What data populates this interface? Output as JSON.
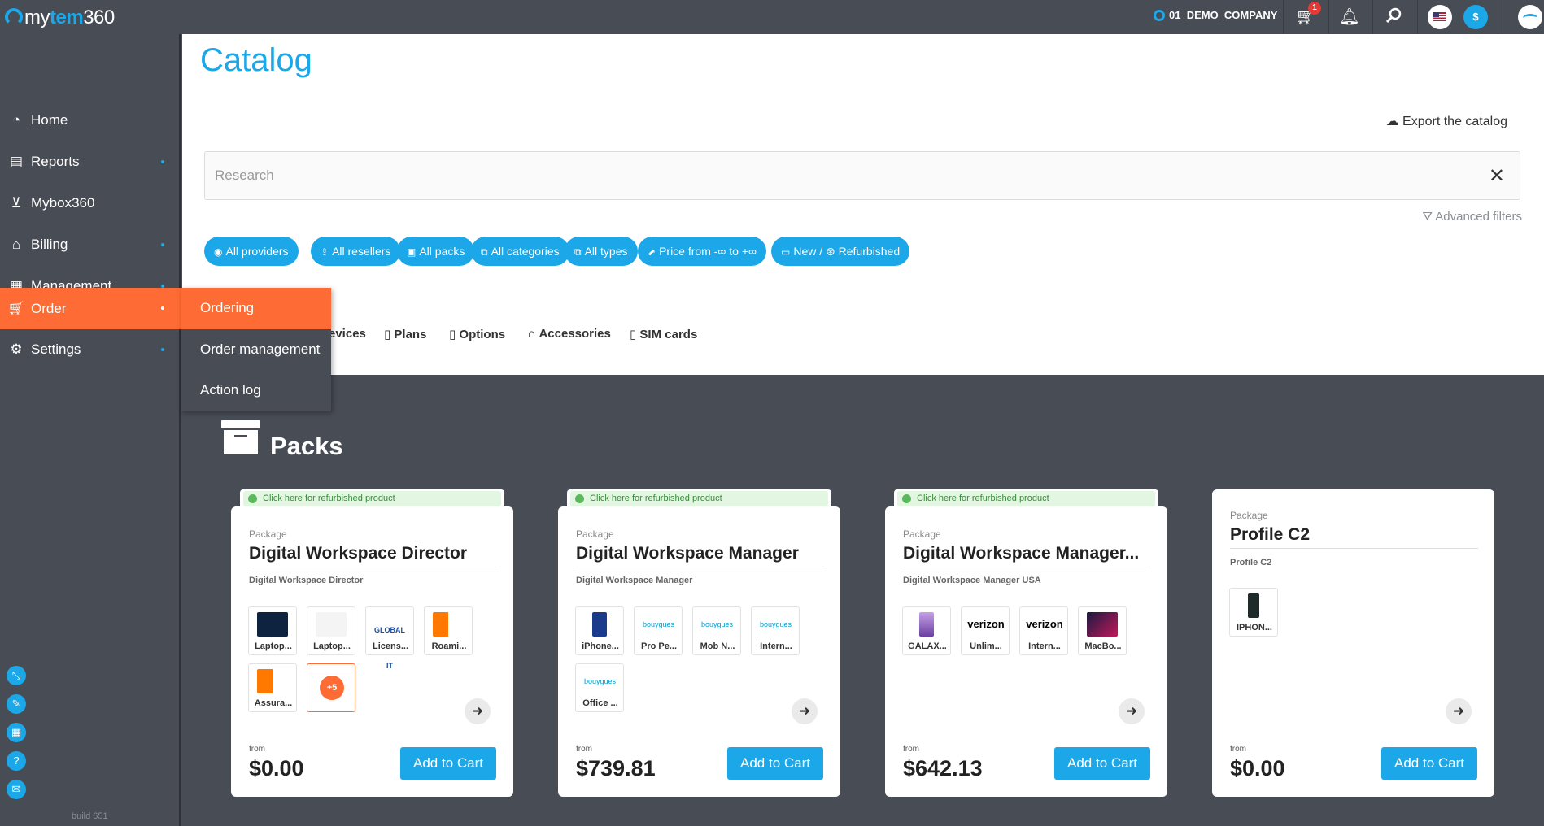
{
  "app": {
    "logo_text_a": "my",
    "logo_text_b": "tem",
    "logo_text_c": "360",
    "company": "01_DEMO_COMPANY",
    "cart_count": "1",
    "currency_symbol": "$",
    "build": "build 651",
    "accent_color": "#1ba7e8",
    "active_color": "#ff6b35"
  },
  "sidebar": {
    "items": [
      {
        "label": "Home",
        "icon": "dashboard-gauge-icon"
      },
      {
        "label": "Reports",
        "icon": "report-icon"
      },
      {
        "label": "Mybox360",
        "icon": "inbox-tray-icon"
      },
      {
        "label": "Billing",
        "icon": "bank-icon"
      },
      {
        "label": "Management",
        "icon": "management-grid-icon"
      },
      {
        "label": "Order",
        "icon": "cart-icon"
      },
      {
        "label": "Settings",
        "icon": "gear-icon"
      }
    ],
    "submenu": [
      "Ordering",
      "Order management",
      "Action log"
    ]
  },
  "main": {
    "title": "Catalog",
    "export_label": "Export the catalog",
    "search_placeholder": "Research",
    "advanced_filters": "Advanced filters",
    "chips": [
      "All providers",
      "All resellers",
      "All packs",
      "All categories",
      "All types",
      "Price from -∞ to +∞",
      "New / ⊛ Refurbished"
    ],
    "tabs": [
      "evices",
      "Plans",
      "Options",
      "Accessories",
      "SIM cards"
    ],
    "section_title": "Packs"
  },
  "cards": [
    {
      "refurb": "Click here for refurbished product",
      "label": "Package",
      "name": "Digital Workspace Director",
      "sub": "Digital Workspace Director",
      "items": [
        "Laptop...",
        "Laptop...",
        "Licens...",
        "Roami...",
        "Assura..."
      ],
      "more": "+5",
      "from": "from",
      "price": "$0.00",
      "cta": "Add to Cart"
    },
    {
      "refurb": "Click here for refurbished product",
      "label": "Package",
      "name": "Digital Workspace Manager",
      "sub": "Digital Workspace Manager",
      "items": [
        "iPhone...",
        "Pro Pe...",
        "Mob N...",
        "Intern...",
        "Office ..."
      ],
      "from": "from",
      "price": "$739.81",
      "cta": "Add to Cart"
    },
    {
      "refurb": "Click here for refurbished product",
      "label": "Package",
      "name": "Digital Workspace Manager...",
      "sub": "Digital Workspace Manager USA",
      "items": [
        "GALAX...",
        "Unlim...",
        "Intern...",
        "MacBo..."
      ],
      "from": "from",
      "price": "$642.13",
      "cta": "Add to Cart"
    },
    {
      "label": "Package",
      "name": "Profile C2",
      "sub": "Profile C2",
      "items": [
        "IPHON..."
      ],
      "from": "from",
      "price": "$0.00",
      "cta": "Add to Cart"
    }
  ]
}
